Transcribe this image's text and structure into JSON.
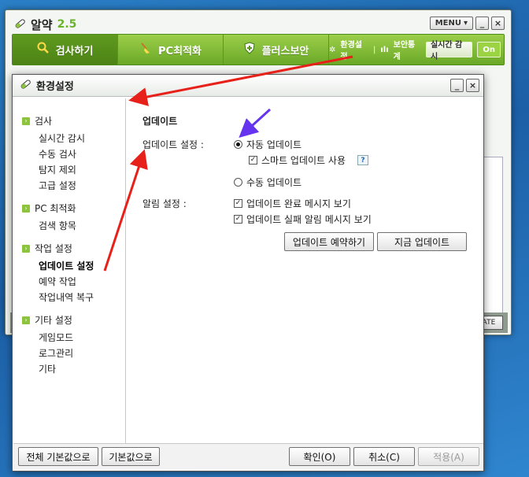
{
  "main": {
    "logo_text": "알약",
    "version": "2.5",
    "menu_label": "MENU",
    "minimize": "_",
    "close": "×",
    "tabs": [
      {
        "label": "검사하기"
      },
      {
        "label": "PC최적화"
      },
      {
        "label": "플러스보안"
      }
    ],
    "settings_link": "환경설정",
    "security_stats": "보안통계",
    "realtime_label": "실시간 감시",
    "on_label": "On",
    "bg_button": "ATE"
  },
  "dialog": {
    "title": "환경설정",
    "minimize": "_",
    "close": "×",
    "sidebar": [
      {
        "label": "검사",
        "items": [
          "실시간 감시",
          "수동 검사",
          "탐지 제외",
          "고급 설정"
        ]
      },
      {
        "label": "PC 최적화",
        "items": [
          "검색 항목"
        ]
      },
      {
        "label": "작업 설정",
        "items": [
          "업데이트 설정",
          "예약 작업",
          "작업내역 복구"
        ]
      },
      {
        "label": "기타 설정",
        "items": [
          "게임모드",
          "로그관리",
          "기타"
        ]
      }
    ],
    "section_title": "업데이트",
    "update_setting_label": "업데이트 설정 :",
    "auto_update": "자동 업데이트",
    "smart_update": "스마트 업데이트 사용",
    "help": "?",
    "manual_update": "수동 업데이트",
    "alert_setting_label": "알림 설정 :",
    "alert_complete": "업데이트 완료 메시지 보기",
    "alert_fail": "업데이트 실패 알림 메시지 보기",
    "schedule_button": "업데이트 예약하기",
    "update_now_button": "지금 업데이트",
    "footer": {
      "reset_all": "전체 기본값으로",
      "reset": "기본값으로",
      "ok": "확인(O)",
      "cancel": "취소(C)",
      "apply": "적용(A)"
    }
  },
  "colors": {
    "accent_green": "#7cb733",
    "annotation_red": "#e8201a",
    "annotation_purple": "#6633ee"
  }
}
